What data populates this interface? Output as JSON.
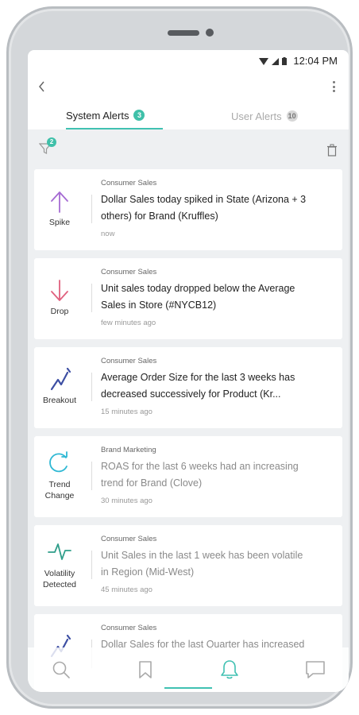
{
  "status_bar": {
    "time": "12:04 PM"
  },
  "tabs": [
    {
      "label": "System Alerts",
      "count": "3"
    },
    {
      "label": "User Alerts",
      "count": "10"
    }
  ],
  "filter": {
    "count": "2"
  },
  "colors": {
    "accent": "#40c1b2",
    "badge": "#3fc0a9",
    "spike": "#a56bd3",
    "drop": "#e0607e",
    "breakout": "#3d4fa3",
    "trend": "#2fb8d4",
    "volatility": "#2f9e8a"
  },
  "alerts": [
    {
      "type": "Spike",
      "icon": "arrow-up-icon",
      "category": "Consumer Sales",
      "line1": "Dollar Sales today spiked in State (Arizona + 3",
      "line2": "others) for Brand (Kruffles)",
      "time": "now"
    },
    {
      "type": "Drop",
      "icon": "arrow-down-icon",
      "category": "Consumer Sales",
      "line1": "Unit sales today dropped below the Average",
      "line2": "Sales in Store (#NYCB12)",
      "time": "few minutes ago"
    },
    {
      "type": "Breakout",
      "icon": "breakout-icon",
      "category": "Consumer Sales",
      "line1": "Average Order Size for the last 3 weeks has",
      "line2": "decreased successively for Product (Kr...",
      "time": "15 minutes ago"
    },
    {
      "type_line1": "Trend",
      "type_line2": "Change",
      "icon": "trend-change-icon",
      "category": "Brand Marketing",
      "line1": "ROAS for the last 6 weeks had an increasing",
      "line2": "trend for Brand (Clove)",
      "time": "30 minutes ago"
    },
    {
      "type_line1": "Volatility",
      "type_line2": "Detected",
      "icon": "pulse-icon",
      "category": "Consumer Sales",
      "line1": "Unit Sales in the last 1 week has been volatile",
      "line2": "in Region (Mid-West)",
      "time": "45 minutes ago"
    },
    {
      "icon": "breakout-icon",
      "category": "Consumer Sales",
      "line1": "Dollar Sales for the last Quarter has increased"
    }
  ],
  "nav": [
    "search-icon",
    "bookmark-icon",
    "bell-icon",
    "chat-icon"
  ]
}
